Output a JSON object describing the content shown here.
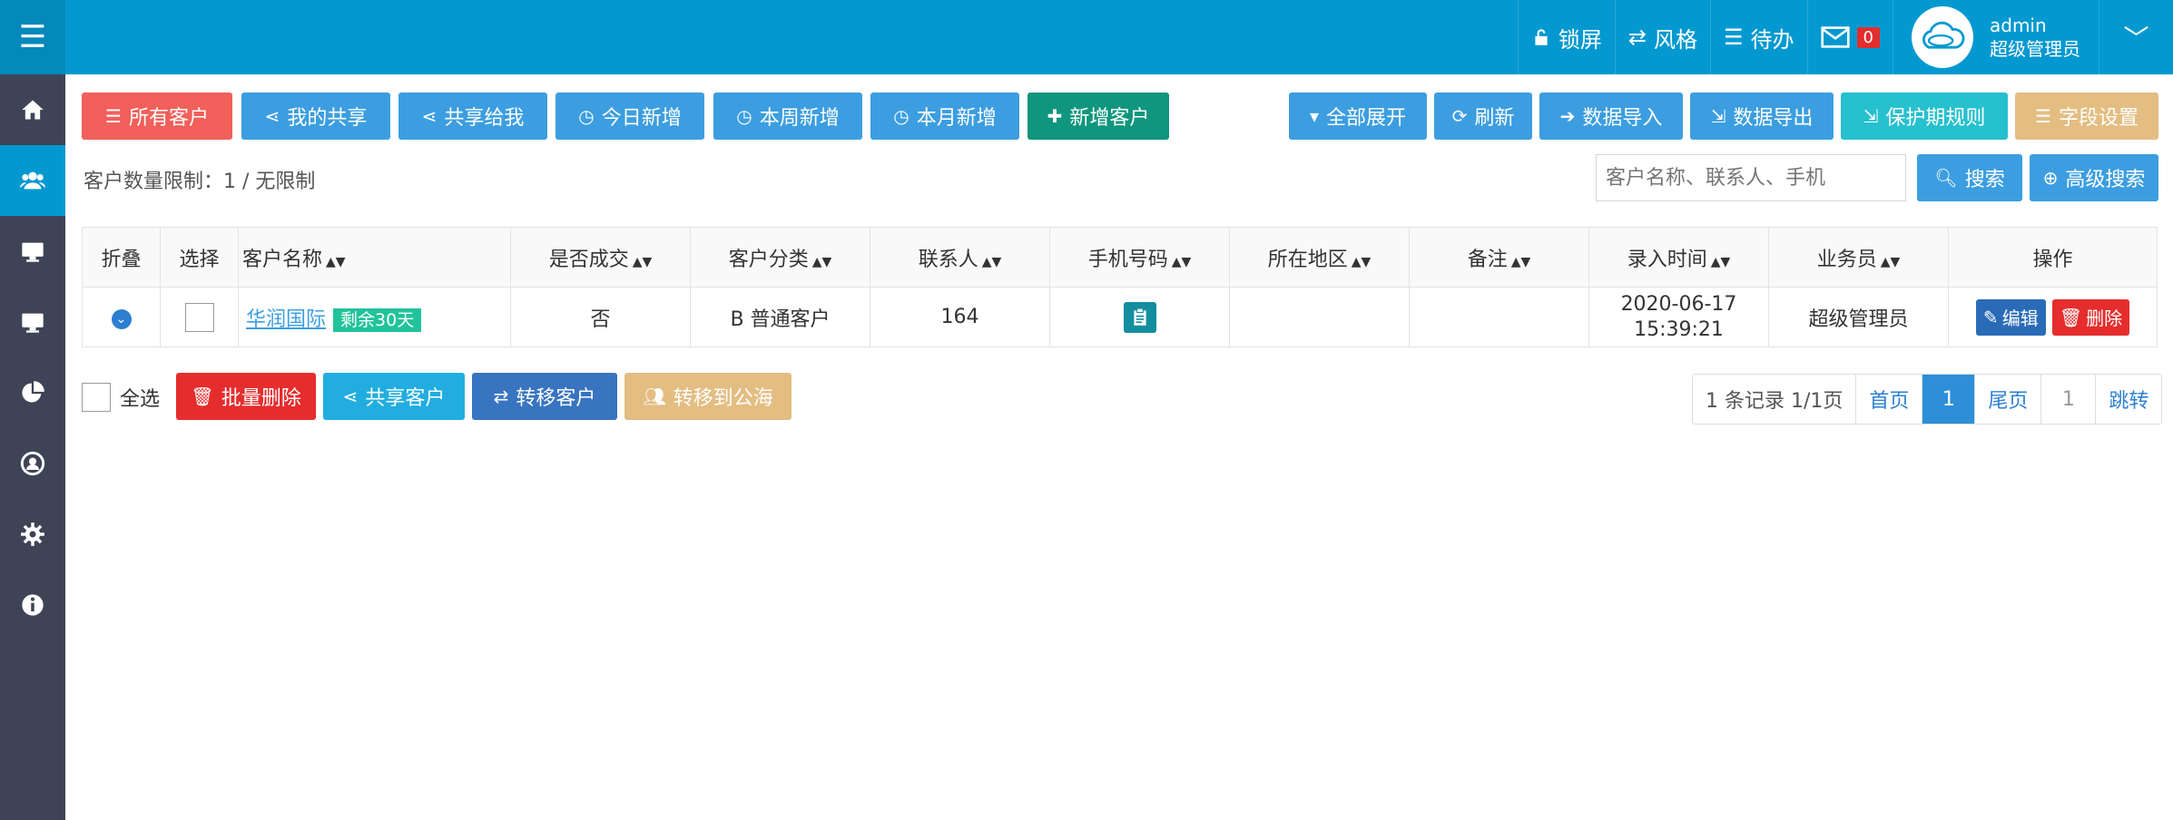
{
  "header": {
    "lock_label": "锁屏",
    "style_label": "风格",
    "todo_label": "待办",
    "msg_count": "0",
    "user_name": "admin",
    "user_role": "超级管理员"
  },
  "toolbar": {
    "all_customers": "所有客户",
    "my_share": "我的共享",
    "shared_to_me": "共享给我",
    "today_new": "今日新增",
    "week_new": "本周新增",
    "month_new": "本月新增",
    "add_customer": "新增客户",
    "expand_all": "全部展开",
    "refresh": "刷新",
    "import": "数据导入",
    "export": "数据导出",
    "protect_rule": "保护期规则",
    "field_settings": "字段设置"
  },
  "limit_text": "客户数量限制：1 / 无限制",
  "search": {
    "placeholder": "客户名称、联系人、手机",
    "search_label": "搜索",
    "advanced_label": "高级搜索"
  },
  "table": {
    "headers": {
      "fold": "折叠",
      "select": "选择",
      "name": "客户名称",
      "deal": "是否成交",
      "category": "客户分类",
      "contact": "联系人",
      "phone": "手机号码",
      "region": "所在地区",
      "note": "备注",
      "created": "录入时间",
      "salesman": "业务员",
      "ops": "操作"
    },
    "rows": [
      {
        "name": "华润国际",
        "remain": "剩余30天",
        "deal": "否",
        "category": "B 普通客户",
        "contact": "164",
        "region": "",
        "note": "",
        "created_date": "2020-06-17",
        "created_time": "15:39:21",
        "salesman": "超级管理员",
        "edit": "编辑",
        "delete": "删除"
      }
    ]
  },
  "bulk": {
    "select_all": "全选",
    "batch_delete": "批量删除",
    "share": "共享客户",
    "transfer": "转移客户",
    "to_public": "转移到公海"
  },
  "pager": {
    "summary": "1 条记录 1/1页",
    "first": "首页",
    "current": "1",
    "last": "尾页",
    "jump_value": "1",
    "jump": "跳转"
  },
  "colors": {
    "header": "#0399d0",
    "sidebar": "#3e4456",
    "primary": "#3c9ee0"
  }
}
